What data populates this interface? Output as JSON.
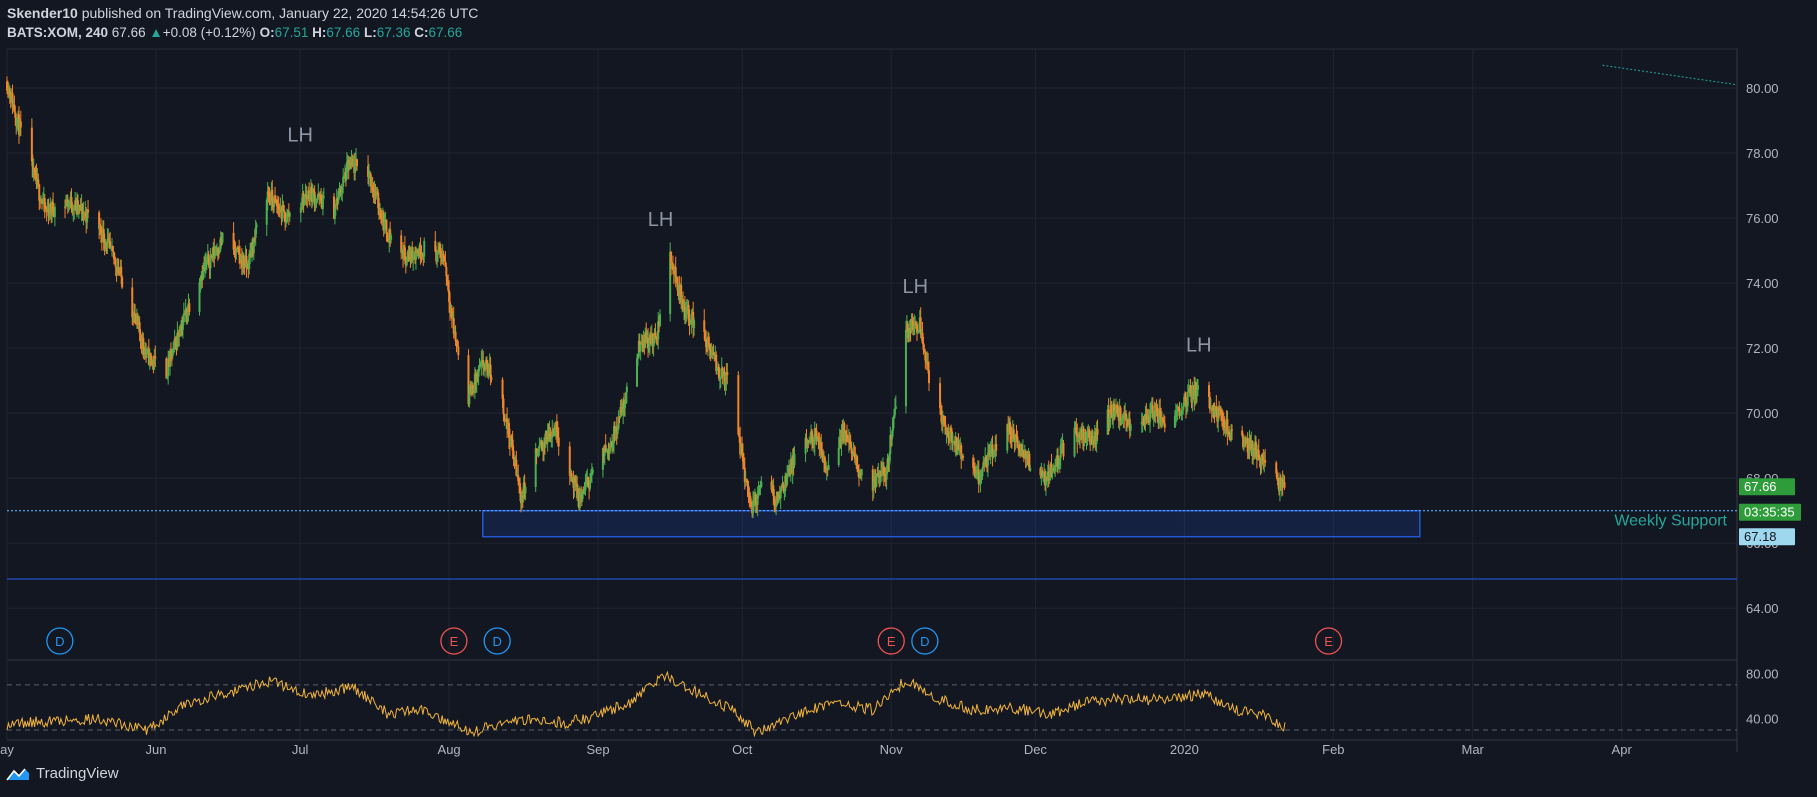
{
  "header": {
    "author": "Skender10",
    "published_text": "published on TradingView.com, January 22, 2020 14:54:26 UTC",
    "symbol": "BATS:XOM, 240",
    "last": "67.66",
    "change_arrow": "▲",
    "change": "+0.08 (+0.12%)",
    "o_label": "O:",
    "o_value": "67.51",
    "h_label": "H:",
    "h_value": "67.66",
    "l_label": "L:",
    "l_value": "67.36",
    "c_label": "C:",
    "c_value": "67.66"
  },
  "footer": {
    "brand": "TradingView",
    "logo_icon": "tradingview-logo-icon"
  },
  "colors": {
    "background": "#131722",
    "up": "#4caf50",
    "down": "#f0862a",
    "grid": "#1f2430",
    "support_box": "#2962ff",
    "text": "#d1d4dc",
    "axis_text": "#b2b5be",
    "price_label_bg": "#2e9c3a",
    "alert_label_bg": "#1e7a8c",
    "support_label_bg": "#9ed8ee",
    "oscillator_line": "#f0b33b",
    "earnings": "#ef5350",
    "dividend": "#2196f3",
    "annotation_text": "#8c96a6",
    "weekly_support_text": "#26a69a"
  },
  "chart_data": {
    "type": "candlestick",
    "title": "",
    "xlabel": "",
    "ylabel": "",
    "ylim": [
      62.5,
      81.2
    ],
    "y_ticks": [
      64,
      66,
      68,
      70,
      72,
      74,
      76,
      78,
      80
    ],
    "y_tick_labels": [
      "64.00",
      "66.00",
      "68.00",
      "70.00",
      "72.00",
      "74.00",
      "76.00",
      "78.00",
      "80.00"
    ],
    "x_tick_labels": [
      "ay",
      "Jun",
      "Jul",
      "Aug",
      "Sep",
      "Oct",
      "Nov",
      "Dec",
      "2020",
      "Feb",
      "Mar",
      "Apr"
    ],
    "x_tick_dates": [
      "2019-05-01",
      "2019-06-01",
      "2019-07-01",
      "2019-08-01",
      "2019-09-01",
      "2019-10-01",
      "2019-11-01",
      "2019-12-01",
      "2020-01-01",
      "2020-02-01",
      "2020-03-01",
      "2020-04-01"
    ],
    "x_range": [
      "2019-05-01",
      "2020-04-25"
    ],
    "grid": true,
    "price_path": [
      [
        "2019-05-01",
        80.2
      ],
      [
        "2019-05-05",
        78.0
      ],
      [
        "2019-05-09",
        76.2
      ],
      [
        "2019-05-14",
        76.5
      ],
      [
        "2019-05-20",
        75.8
      ],
      [
        "2019-05-24",
        74.5
      ],
      [
        "2019-05-27",
        73.2
      ],
      [
        "2019-05-30",
        71.8
      ],
      [
        "2019-06-03",
        71.2
      ],
      [
        "2019-06-06",
        72.6
      ],
      [
        "2019-06-10",
        74.2
      ],
      [
        "2019-06-15",
        75.4
      ],
      [
        "2019-06-20",
        74.5
      ],
      [
        "2019-06-24",
        76.8
      ],
      [
        "2019-06-28",
        76.0
      ],
      [
        "2019-07-03",
        76.8
      ],
      [
        "2019-07-08",
        76.2
      ],
      [
        "2019-07-11",
        77.6
      ],
      [
        "2019-07-15",
        77.5
      ],
      [
        "2019-07-19",
        75.6
      ],
      [
        "2019-07-23",
        74.8
      ],
      [
        "2019-07-27",
        75.1
      ],
      [
        "2019-07-31",
        74.8
      ],
      [
        "2019-08-02",
        72.5
      ],
      [
        "2019-08-05",
        70.5
      ],
      [
        "2019-08-08",
        71.5
      ],
      [
        "2019-08-11",
        71.0
      ],
      [
        "2019-08-14",
        69.0
      ],
      [
        "2019-08-16",
        67.4
      ],
      [
        "2019-08-19",
        68.7
      ],
      [
        "2019-08-23",
        69.6
      ],
      [
        "2019-08-26",
        68.3
      ],
      [
        "2019-08-28",
        67.3
      ],
      [
        "2019-08-31",
        68.2
      ],
      [
        "2019-09-04",
        69.2
      ],
      [
        "2019-09-07",
        70.6
      ],
      [
        "2019-09-10",
        72.3
      ],
      [
        "2019-09-13",
        72.2
      ],
      [
        "2019-09-16",
        74.8
      ],
      [
        "2019-09-19",
        73.2
      ],
      [
        "2019-09-23",
        72.4
      ],
      [
        "2019-09-26",
        71.3
      ],
      [
        "2019-09-29",
        70.8
      ],
      [
        "2019-10-01",
        68.5
      ],
      [
        "2019-10-03",
        67.1
      ],
      [
        "2019-10-06",
        68.0
      ],
      [
        "2019-10-08",
        67.3
      ],
      [
        "2019-10-12",
        68.6
      ],
      [
        "2019-10-16",
        69.3
      ],
      [
        "2019-10-19",
        68.2
      ],
      [
        "2019-10-22",
        69.5
      ],
      [
        "2019-10-25",
        68.3
      ],
      [
        "2019-10-28",
        67.8
      ],
      [
        "2019-10-31",
        68.2
      ],
      [
        "2019-11-02",
        70.5
      ],
      [
        "2019-11-04",
        72.5
      ],
      [
        "2019-11-07",
        72.8
      ],
      [
        "2019-11-09",
        71.0
      ],
      [
        "2019-11-12",
        69.6
      ],
      [
        "2019-11-16",
        68.6
      ],
      [
        "2019-11-19",
        68.0
      ],
      [
        "2019-11-22",
        68.8
      ],
      [
        "2019-11-25",
        69.6
      ],
      [
        "2019-11-29",
        68.6
      ],
      [
        "2019-12-03",
        68.0
      ],
      [
        "2019-12-06",
        68.7
      ],
      [
        "2019-12-09",
        69.4
      ],
      [
        "2019-12-13",
        69.2
      ],
      [
        "2019-12-17",
        70.1
      ],
      [
        "2019-12-21",
        69.6
      ],
      [
        "2019-12-25",
        70.0
      ],
      [
        "2019-12-29",
        69.7
      ],
      [
        "2020-01-01",
        70.4
      ],
      [
        "2020-01-04",
        70.8
      ],
      [
        "2020-01-07",
        70.2
      ],
      [
        "2020-01-10",
        69.5
      ],
      [
        "2020-01-13",
        69.2
      ],
      [
        "2020-01-16",
        68.8
      ],
      [
        "2020-01-19",
        68.1
      ],
      [
        "2020-01-22",
        67.66
      ]
    ],
    "annotations": [
      {
        "text": "LH",
        "date": "2019-07-01",
        "price": 78.35
      },
      {
        "text": "LH",
        "date": "2019-09-14",
        "price": 75.75
      },
      {
        "text": "LH",
        "date": "2019-11-06",
        "price": 73.7
      },
      {
        "text": "LH",
        "date": "2020-01-04",
        "price": 71.9
      }
    ],
    "support_zone": {
      "from": "2019-08-08",
      "to": "2020-02-19",
      "top": 67.0,
      "bottom": 66.2
    },
    "support_line": {
      "price": 67.0
    },
    "lower_line": {
      "price": 64.9
    },
    "trend_line_fragment": {
      "from_date": "2020-03-28",
      "from_price": 80.7,
      "to_date": "2020-04-25",
      "to_price": 80.1
    },
    "weekly_support_label": "Weekly Support",
    "price_labels": [
      {
        "text": "67.66",
        "price": 67.66,
        "kind": "last"
      },
      {
        "text": "03:35:35",
        "price": 67.0,
        "kind": "countdown"
      },
      {
        "text": "67.18",
        "price": 66.4,
        "kind": "support"
      }
    ],
    "events": [
      {
        "letter": "D",
        "date": "2019-05-12",
        "kind": "dividend"
      },
      {
        "letter": "E",
        "date": "2019-08-02",
        "kind": "earnings"
      },
      {
        "letter": "D",
        "date": "2019-08-11",
        "kind": "dividend"
      },
      {
        "letter": "E",
        "date": "2019-11-01",
        "kind": "earnings"
      },
      {
        "letter": "D",
        "date": "2019-11-08",
        "kind": "dividend"
      },
      {
        "letter": "E",
        "date": "2020-01-31",
        "kind": "earnings"
      }
    ],
    "oscillator": {
      "ylim": [
        22,
        92
      ],
      "y_tick_labels": [
        "80.00",
        "40.00"
      ],
      "y_ticks": [
        80,
        40
      ],
      "dashed_levels": [
        70,
        30
      ],
      "values": [
        [
          "2019-05-01",
          35
        ],
        [
          "2019-05-10",
          38
        ],
        [
          "2019-05-20",
          40
        ],
        [
          "2019-05-30",
          30
        ],
        [
          "2019-06-08",
          55
        ],
        [
          "2019-06-18",
          65
        ],
        [
          "2019-06-25",
          74
        ],
        [
          "2019-07-03",
          60
        ],
        [
          "2019-07-12",
          68
        ],
        [
          "2019-07-19",
          45
        ],
        [
          "2019-07-26",
          48
        ],
        [
          "2019-08-01",
          38
        ],
        [
          "2019-08-06",
          28
        ],
        [
          "2019-08-11",
          35
        ],
        [
          "2019-08-18",
          40
        ],
        [
          "2019-08-25",
          36
        ],
        [
          "2019-08-31",
          42
        ],
        [
          "2019-09-08",
          55
        ],
        [
          "2019-09-15",
          78
        ],
        [
          "2019-09-22",
          62
        ],
        [
          "2019-09-29",
          48
        ],
        [
          "2019-10-04",
          28
        ],
        [
          "2019-10-11",
          42
        ],
        [
          "2019-10-20",
          55
        ],
        [
          "2019-10-28",
          48
        ],
        [
          "2019-11-04",
          74
        ],
        [
          "2019-11-10",
          58
        ],
        [
          "2019-11-18",
          48
        ],
        [
          "2019-11-26",
          50
        ],
        [
          "2019-12-04",
          44
        ],
        [
          "2019-12-12",
          55
        ],
        [
          "2019-12-20",
          58
        ],
        [
          "2019-12-28",
          56
        ],
        [
          "2020-01-05",
          62
        ],
        [
          "2020-01-12",
          48
        ],
        [
          "2020-01-18",
          44
        ],
        [
          "2020-01-22",
          32
        ]
      ]
    }
  }
}
